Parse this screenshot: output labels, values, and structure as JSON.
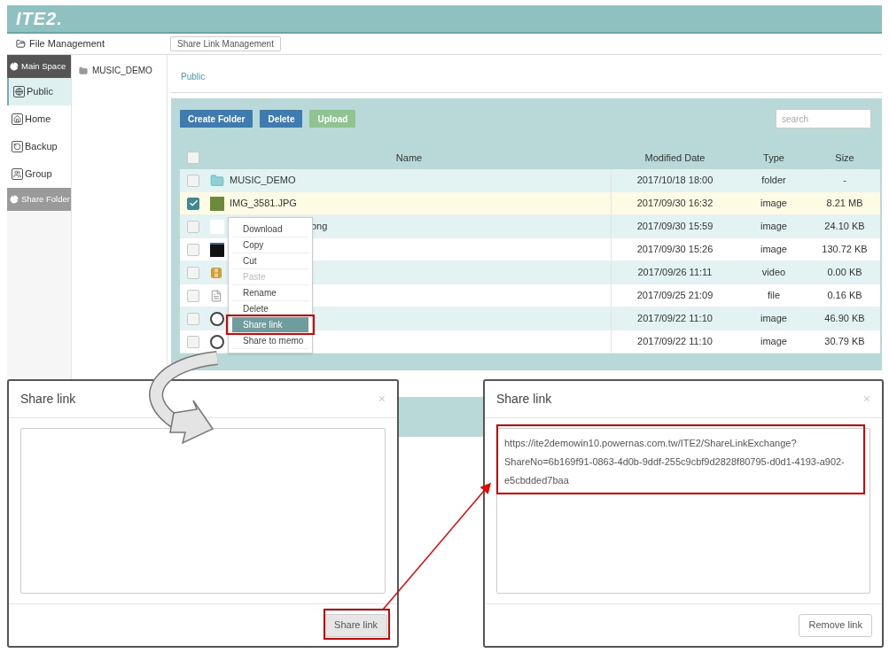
{
  "app": {
    "logo": "ITE2."
  },
  "toolbar": {
    "title": "File Management",
    "button": "Share Link Management"
  },
  "sidebar": {
    "sections": [
      {
        "title": "Main Space",
        "expanded": true,
        "items": [
          {
            "label": "Public",
            "selected": true
          },
          {
            "label": "Home",
            "selected": false
          },
          {
            "label": "Backup",
            "selected": false
          },
          {
            "label": "Group",
            "selected": false
          }
        ]
      },
      {
        "title": "Share Folder",
        "expanded": false
      }
    ]
  },
  "tree": [
    "MUSIC_DEMO"
  ],
  "breadcrumb": "Public",
  "actions": [
    {
      "label": "Create Folder",
      "kind": "primary"
    },
    {
      "label": "Delete",
      "kind": "primary"
    },
    {
      "label": "Upload",
      "kind": "success"
    }
  ],
  "search": {
    "placeholder": "search"
  },
  "table": {
    "columns": [
      "Name",
      "Modified Date",
      "Type",
      "Size"
    ],
    "all_checked": false,
    "rows": [
      {
        "checked": false,
        "kind": "folder",
        "name": "MUSIC_DEMO",
        "modified": "2017/10/18 18:00",
        "file_type": "folder",
        "size": "-"
      },
      {
        "checked": true,
        "kind": "photo",
        "name": "IMG_3581.JPG",
        "modified": "2017/09/30 16:32",
        "file_type": "image",
        "size": "8.21 MB"
      },
      {
        "checked": false,
        "kind": "blank",
        "name": "ong",
        "modified": "2017/09/30 15:59",
        "file_type": "image",
        "size": "24.10 KB"
      },
      {
        "checked": false,
        "kind": "dark",
        "modified": "2017/09/30 15:26",
        "file_type": "image",
        "size": "130.72 KB"
      },
      {
        "checked": false,
        "kind": "video",
        "modified": "2017/09/26 11:11",
        "file_type": "video",
        "size": "0.00 KB"
      },
      {
        "checked": false,
        "kind": "file",
        "modified": "2017/09/25 21:09",
        "file_type": "file",
        "size": "0.16 KB"
      },
      {
        "checked": false,
        "kind": "sketch",
        "modified": "2017/09/22 11:10",
        "file_type": "image",
        "size": "46.90 KB"
      },
      {
        "checked": false,
        "kind": "sketch",
        "modified": "2017/09/22 11:10",
        "file_type": "image",
        "size": "30.79 KB"
      }
    ]
  },
  "context_menu": {
    "items": [
      {
        "label": "Download",
        "disabled": false,
        "selected": false
      },
      {
        "label": "Copy",
        "disabled": false,
        "selected": false
      },
      {
        "label": "Cut",
        "disabled": false,
        "selected": false
      },
      {
        "label": "Paste",
        "disabled": true,
        "selected": false
      },
      {
        "label": "Rename",
        "disabled": false,
        "selected": false
      },
      {
        "label": "Delete",
        "disabled": false,
        "selected": false
      },
      {
        "label": "Share link",
        "disabled": false,
        "selected": true
      },
      {
        "label": "Share to memo",
        "disabled": false,
        "selected": false
      }
    ]
  },
  "dialogs": [
    {
      "title": "Share link",
      "close": "×",
      "button": "Share link",
      "kind": "pressed"
    },
    {
      "title": "Share link",
      "close": "×",
      "value": "https://ite2demowin10.powernas.com.tw/ITE2/ShareLinkExchange?ShareNo=6b169f91-0863-4d0b-9ddf-255c9cbf9d2828f80795-d0d1-4193-a902-e5cbdded7baa",
      "button": "Remove link",
      "kind": "default"
    }
  ]
}
